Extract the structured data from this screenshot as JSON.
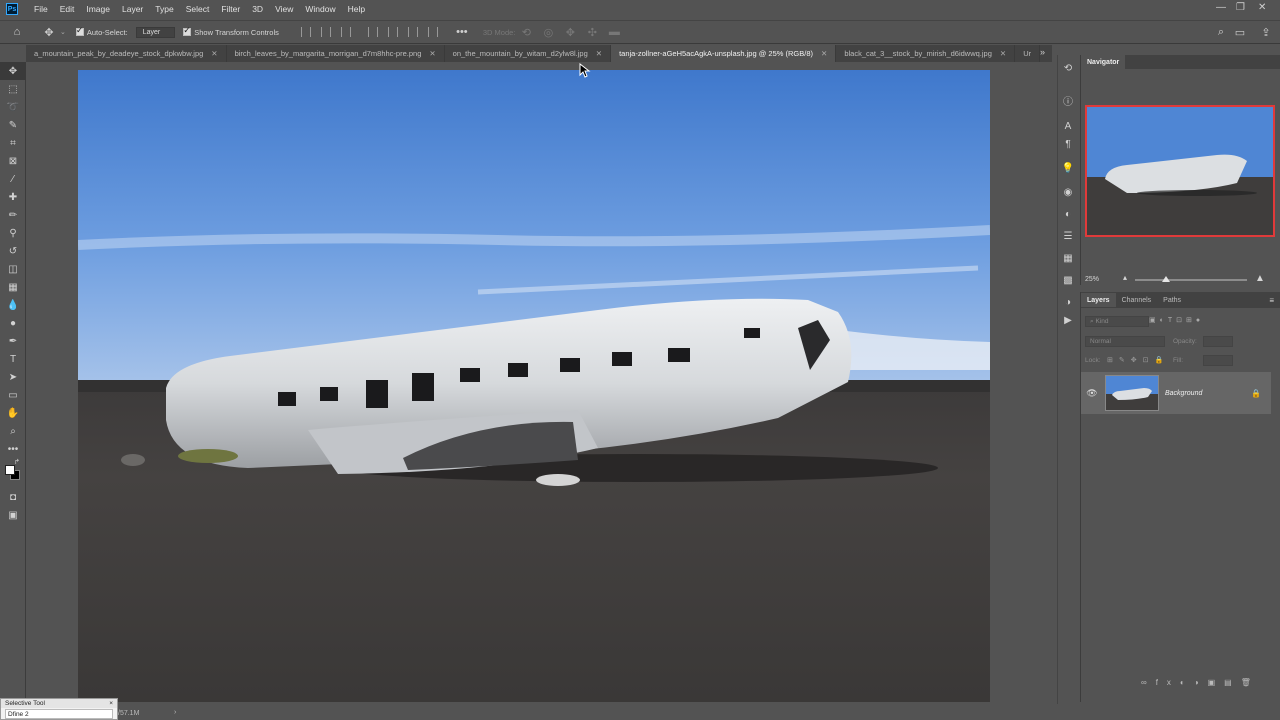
{
  "menubar": {
    "items": [
      "File",
      "Edit",
      "Image",
      "Layer",
      "Type",
      "Select",
      "Filter",
      "3D",
      "View",
      "Window",
      "Help"
    ]
  },
  "options": {
    "auto_select_label": "Auto-Select:",
    "target_value": "Layer",
    "transform_label": "Show Transform Controls",
    "mode_3d_label": "3D Mode:"
  },
  "tabs": [
    {
      "label": "a_mountain_peak_by_deadeye_stock_dpkwbw.jpg",
      "active": false
    },
    {
      "label": "birch_leaves_by_margarita_morrigan_d7m8hhc-pre.png",
      "active": false
    },
    {
      "label": "on_the_mountain_by_witam_d2ylw8l.jpg",
      "active": false
    },
    {
      "label": "tanja-zollner-aGeH5acAgkA-unsplash.jpg @ 25% (RGB/8)",
      "active": true
    },
    {
      "label": "black_cat_3__stock_by_mirish_d6idwwq.jpg",
      "active": false
    },
    {
      "label": "Ur",
      "active": false
    }
  ],
  "navigator": {
    "title": "Navigator",
    "zoom": "25%",
    "zoom_level": 0.28
  },
  "layers_panel": {
    "tabs": [
      "Layers",
      "Channels",
      "Paths"
    ],
    "kind_placeholder": "Kind",
    "blend_mode": "Normal",
    "opacity_label": "Opacity:",
    "lock_label": "Lock:",
    "fill_label": "Fill:",
    "layer_name": "Background"
  },
  "status": {
    "doc_size": "/57.1M"
  },
  "float_window": {
    "title": "Selective Tool",
    "item": "Dfine 2"
  }
}
